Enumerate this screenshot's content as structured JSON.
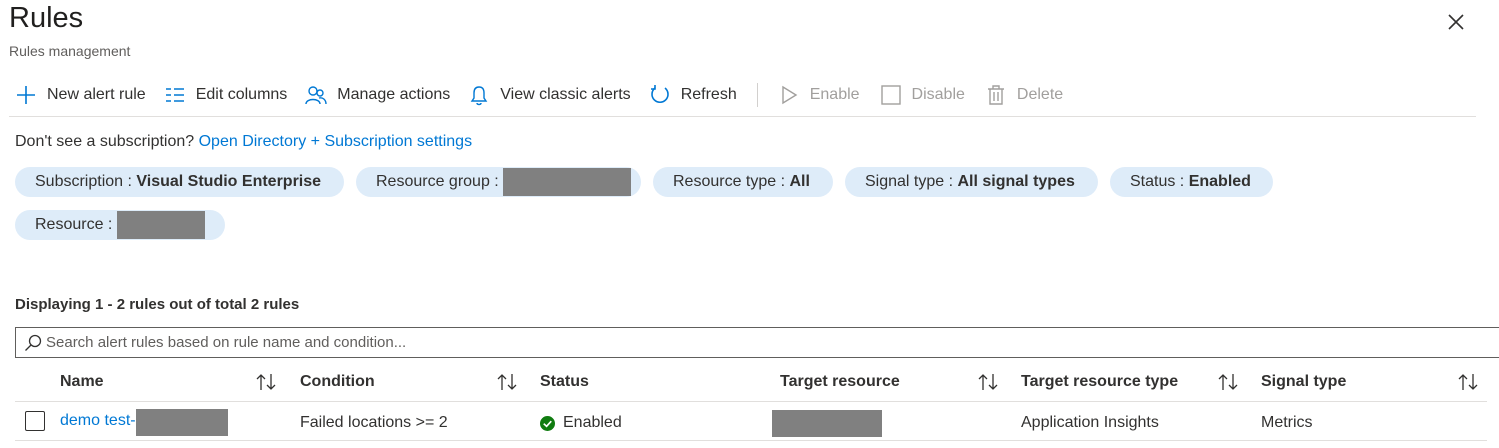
{
  "header": {
    "title": "Rules",
    "subtitle": "Rules management"
  },
  "toolbar": {
    "new_alert_rule": "New alert rule",
    "edit_columns": "Edit columns",
    "manage_actions": "Manage actions",
    "view_classic_alerts": "View classic alerts",
    "refresh": "Refresh",
    "enable": "Enable",
    "disable": "Disable",
    "delete": "Delete"
  },
  "subscription_note": {
    "text": "Don't see a subscription?",
    "link": "Open Directory + Subscription settings"
  },
  "filters": {
    "subscription": {
      "label": "Subscription : ",
      "value": "Visual Studio Enterprise"
    },
    "resource_group": {
      "label": "Resource group : "
    },
    "resource_type": {
      "label": "Resource type : ",
      "value": "All"
    },
    "signal_type": {
      "label": "Signal type : ",
      "value": "All signal types"
    },
    "status": {
      "label": "Status : ",
      "value": "Enabled"
    },
    "resource": {
      "label": "Resource : "
    }
  },
  "list": {
    "count_text": "Displaying 1 - 2 rules out of total 2 rules",
    "search_placeholder": "Search alert rules based on rule name and condition...",
    "columns": [
      "Name",
      "Condition",
      "Status",
      "Target resource",
      "Target resource type",
      "Signal type"
    ],
    "rows": [
      {
        "name": "demo test-",
        "condition": "Failed locations >= 2",
        "status": "Enabled",
        "target_resource_type": "Application Insights",
        "signal_type": "Metrics"
      }
    ]
  },
  "colors": {
    "accent": "#0078d4",
    "pill_background": "#deecf9",
    "status_success": "#107c10",
    "redaction": "#808080"
  },
  "icons": {
    "close": "close-icon",
    "new_alert_rule": "plus-icon",
    "edit_columns": "columns-icon",
    "manage_actions": "people-icon",
    "view_classic_alerts": "bell-icon",
    "refresh": "refresh-icon",
    "enable": "play-icon",
    "disable": "stop-icon",
    "delete": "trash-icon",
    "search": "search-icon",
    "sort": "sort-icon",
    "status": "check-circle-icon"
  }
}
